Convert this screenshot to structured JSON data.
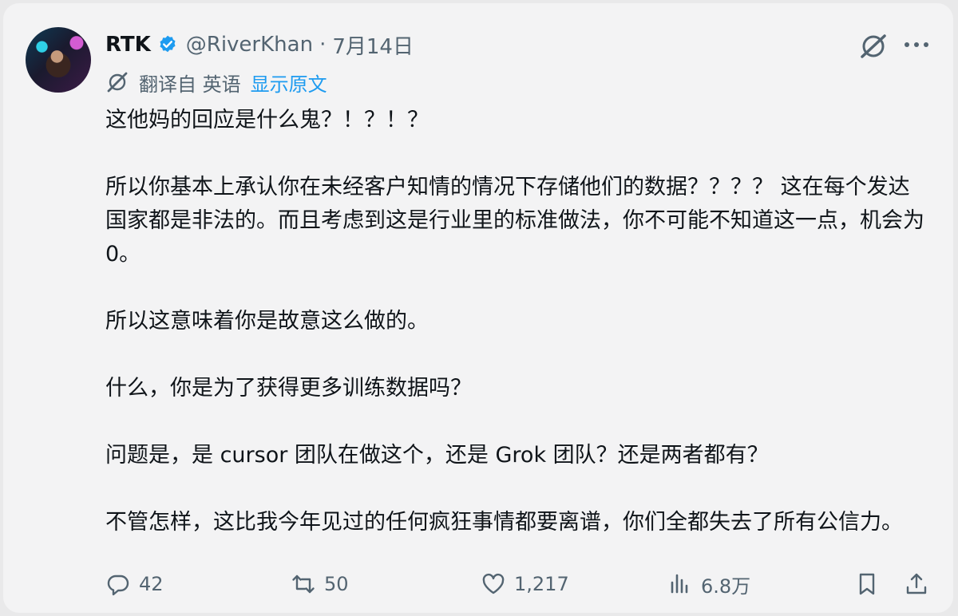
{
  "tweet": {
    "author": {
      "name": "RTK",
      "handle": "@RiverKhan",
      "separator": "·",
      "time": "7月14日"
    },
    "translation": {
      "label": "翻译自 英语",
      "link": "显示原文"
    },
    "paragraphs": [
      "这他妈的回应是什么鬼？！？！？",
      "所以你基本上承认你在未经客户知情的情况下存储他们的数据？？？？ 这在每个发达国家都是非法的。而且考虑到这是行业里的标准做法，你不可能不知道这一点，机会为0。",
      "所以这意味着你是故意这么做的。",
      "什么，你是为了获得更多训练数据吗？",
      "问题是，是 cursor 团队在做这个，还是 Grok 团队？还是两者都有？",
      "不管怎样，这比我今年见过的任何疯狂事情都要离谱，你们全都失去了所有公信力。"
    ],
    "stats": {
      "replies": "42",
      "retweets": "50",
      "likes": "1,217",
      "views": "6.8万"
    },
    "icons": {
      "verified": "verified-badge-icon",
      "grok": "grok-icon",
      "more": "more-icon",
      "translate": "translate-icon",
      "reply": "reply-icon",
      "retweet": "retweet-icon",
      "like": "heart-icon",
      "views": "views-chart-icon",
      "bookmark": "bookmark-icon",
      "share": "share-icon"
    },
    "colors": {
      "accent": "#1d9bf0",
      "text": "#0f1419",
      "secondary": "#536471",
      "card": "#f3f3f4"
    }
  }
}
